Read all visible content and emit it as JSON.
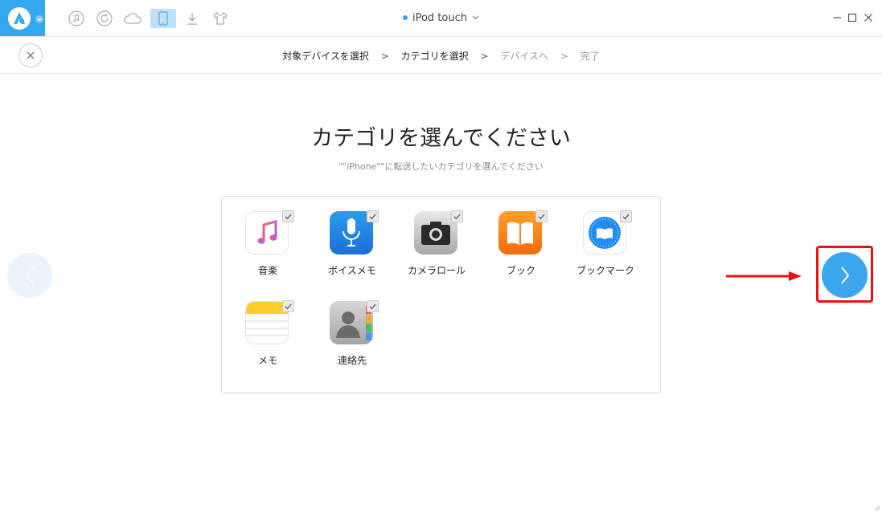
{
  "app": {
    "device_name": "iPod touch",
    "toolbar_icons": [
      "music-icon",
      "restore-icon",
      "cloud-icon",
      "device-icon",
      "download-icon",
      "tshirt-icon"
    ],
    "active_tool": "device-icon"
  },
  "breadcrumb": {
    "steps": [
      {
        "label": "対象デバイスを選択",
        "state": "done"
      },
      {
        "label": "カテゴリを選択",
        "state": "done"
      },
      {
        "label": "デバイスへ",
        "state": "todo"
      },
      {
        "label": "完了",
        "state": "todo"
      }
    ],
    "separator": ">"
  },
  "main": {
    "title": "カテゴリを選んでください",
    "subtitle": "\"\"iPhone\"\"に転送したいカテゴリを選んでください"
  },
  "categories": [
    {
      "label": "音楽",
      "icon": "music-app-icon",
      "checked": true
    },
    {
      "label": "ボイスメモ",
      "icon": "voice-memo-icon",
      "checked": true
    },
    {
      "label": "カメラロール",
      "icon": "camera-icon",
      "checked": true
    },
    {
      "label": "ブック",
      "icon": "books-icon",
      "checked": true
    },
    {
      "label": "ブックマーク",
      "icon": "safari-icon",
      "checked": true
    },
    {
      "label": "メモ",
      "icon": "notes-icon",
      "checked": true
    },
    {
      "label": "連絡先",
      "icon": "contacts-icon",
      "checked": true
    }
  ],
  "colors": {
    "accent": "#33a8ee",
    "next_button": "#3aa6ee",
    "highlight": "#ee1111"
  }
}
